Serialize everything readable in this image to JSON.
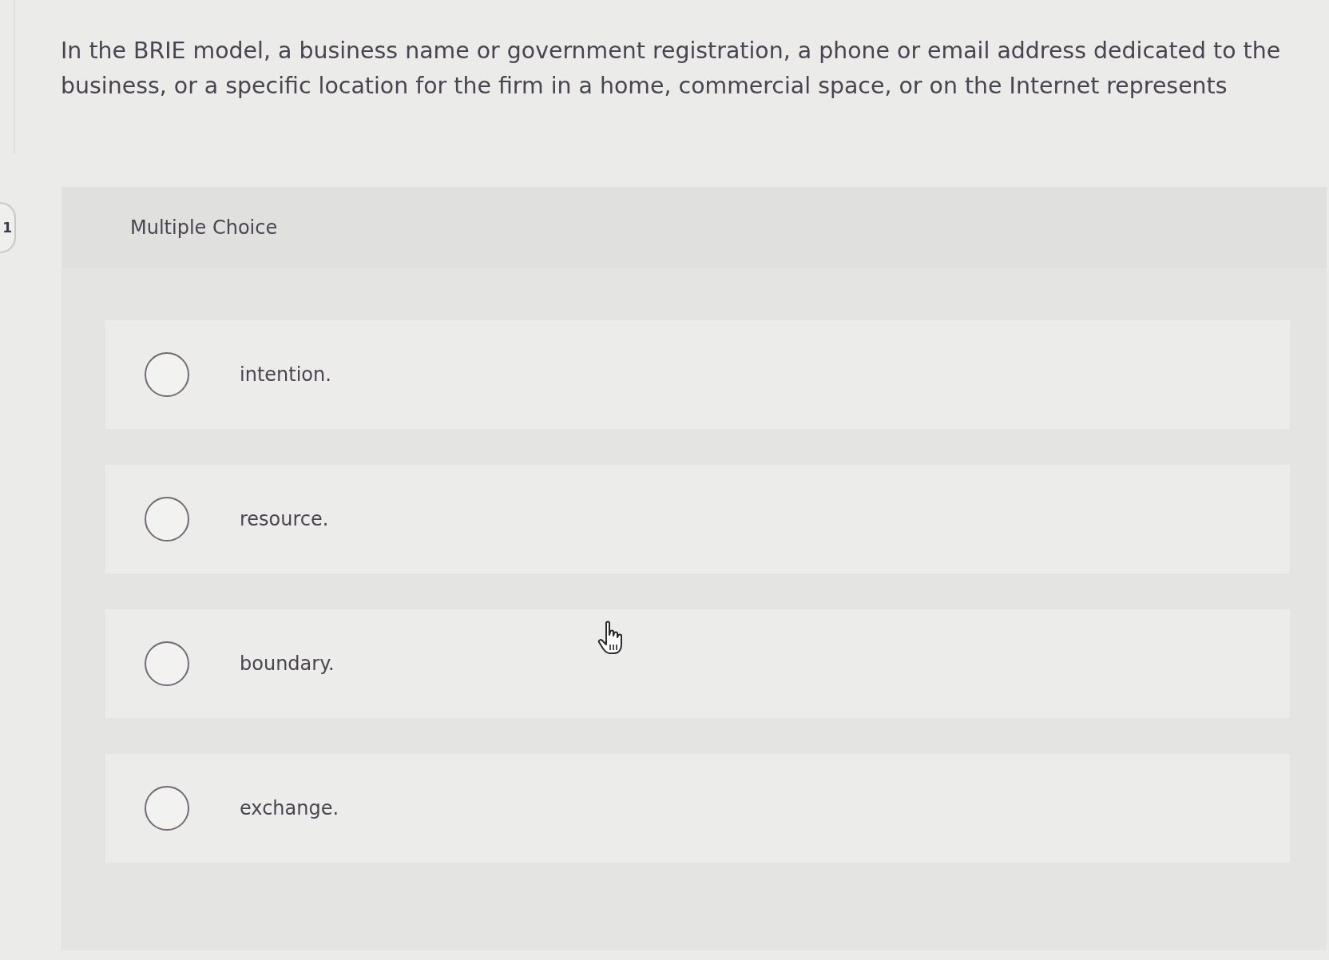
{
  "question": {
    "text": "In the BRIE model, a business name or government registration, a phone or email address dedicated to the business, or a specific location for the firm in a home, commercial space, or on the Internet represents"
  },
  "question_badge": {
    "number": "1"
  },
  "answer_panel": {
    "heading": "Multiple Choice",
    "options": [
      {
        "label": "intention.",
        "selected": false
      },
      {
        "label": "resource.",
        "selected": false
      },
      {
        "label": "boundary.",
        "selected": false
      },
      {
        "label": "exchange.",
        "selected": false
      }
    ]
  }
}
